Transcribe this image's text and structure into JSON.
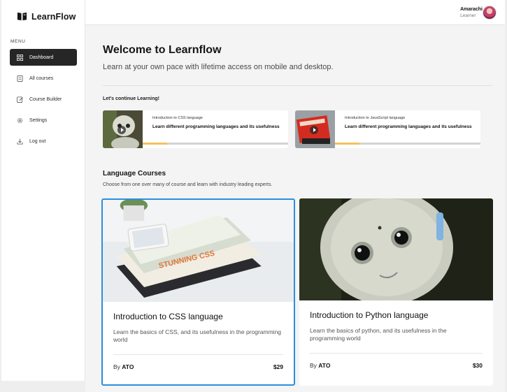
{
  "brand": {
    "name": "LearnFlow"
  },
  "sidebar": {
    "menu_label": "MENU",
    "items": [
      {
        "label": "Dashboard",
        "icon": "dashboard-icon",
        "active": true
      },
      {
        "label": "All courses",
        "icon": "courses-icon",
        "active": false
      },
      {
        "label": "Course Builder",
        "icon": "edit-icon",
        "active": false
      },
      {
        "label": "Settings",
        "icon": "settings-icon",
        "active": false
      },
      {
        "label": "Log out",
        "icon": "logout-icon",
        "active": false
      }
    ]
  },
  "user": {
    "name": "Amarachi",
    "role": "Learner"
  },
  "main": {
    "title": "Welcome to Learnflow",
    "subtitle": "Learn at your own pace with lifetime access on mobile and desktop.",
    "continue_label": "Let's continue Learning!",
    "continue": [
      {
        "course": "Introduction to CSS language",
        "title": "Learn different programming languages and its usefulness",
        "progress": 0.17
      },
      {
        "course": "Introduction to JavaScript language",
        "title": "Learn different programming languages and its usefulness",
        "progress": 0.17
      }
    ],
    "lang_title": "Language Courses",
    "lang_subtitle": "Choose from one over many of course and learn with industry leading experts.",
    "courses": [
      {
        "title": "Introduction to CSS language",
        "desc": "Learn the basics of CSS, and its usefulness in the programming world",
        "by": "By",
        "author": "ATO",
        "price": "$29"
      },
      {
        "title": "Introduction to Python language",
        "desc": "Learn the basics of python, and its usefulness in the programming world",
        "by": "By",
        "author": "ATO",
        "price": "$30"
      }
    ]
  },
  "colors": {
    "accent": "#2b8fdc",
    "progress": "#f1c35b",
    "active_nav": "#262626"
  }
}
